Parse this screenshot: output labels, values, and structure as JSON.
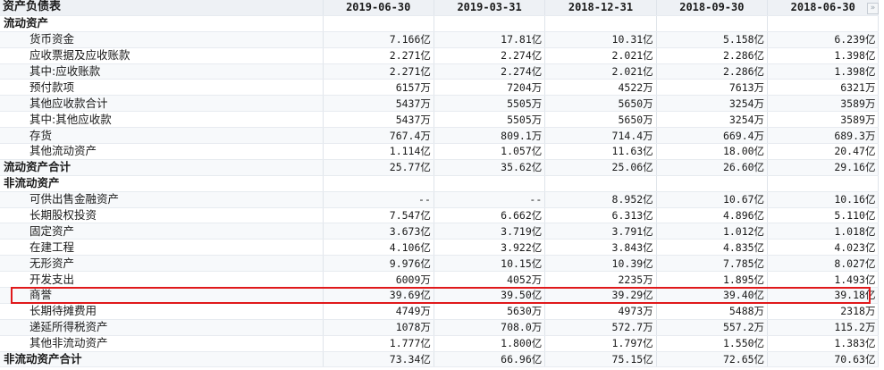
{
  "header": {
    "title": "资产负债表",
    "periods": [
      "2019-06-30",
      "2019-03-31",
      "2018-12-31",
      "2018-09-30",
      "2018-06-30"
    ],
    "scroll_glyph": "»"
  },
  "rows": [
    {
      "name": "流动资产",
      "type": "section",
      "values": [
        "",
        "",
        "",
        "",
        ""
      ]
    },
    {
      "name": "货币资金",
      "type": "sub",
      "values": [
        "7.166亿",
        "17.81亿",
        "10.31亿",
        "5.158亿",
        "6.239亿"
      ]
    },
    {
      "name": "应收票据及应收账款",
      "type": "sub",
      "values": [
        "2.271亿",
        "2.274亿",
        "2.021亿",
        "2.286亿",
        "1.398亿"
      ]
    },
    {
      "name": "其中:应收账款",
      "type": "sub",
      "values": [
        "2.271亿",
        "2.274亿",
        "2.021亿",
        "2.286亿",
        "1.398亿"
      ]
    },
    {
      "name": "预付款项",
      "type": "sub",
      "values": [
        "6157万",
        "7204万",
        "4522万",
        "7613万",
        "6321万"
      ]
    },
    {
      "name": "其他应收款合计",
      "type": "sub",
      "values": [
        "5437万",
        "5505万",
        "5650万",
        "3254万",
        "3589万"
      ]
    },
    {
      "name": "其中:其他应收款",
      "type": "sub",
      "values": [
        "5437万",
        "5505万",
        "5650万",
        "3254万",
        "3589万"
      ]
    },
    {
      "name": "存货",
      "type": "sub",
      "values": [
        "767.4万",
        "809.1万",
        "714.4万",
        "669.4万",
        "689.3万"
      ]
    },
    {
      "name": "其他流动资产",
      "type": "sub",
      "values": [
        "1.114亿",
        "1.057亿",
        "11.63亿",
        "18.00亿",
        "20.47亿"
      ]
    },
    {
      "name": "流动资产合计",
      "type": "section",
      "values": [
        "25.77亿",
        "35.62亿",
        "25.06亿",
        "26.60亿",
        "29.16亿"
      ]
    },
    {
      "name": "非流动资产",
      "type": "section",
      "values": [
        "",
        "",
        "",
        "",
        ""
      ]
    },
    {
      "name": "可供出售金融资产",
      "type": "sub",
      "values": [
        "--",
        "--",
        "8.952亿",
        "10.67亿",
        "10.16亿"
      ]
    },
    {
      "name": "长期股权投资",
      "type": "sub",
      "values": [
        "7.547亿",
        "6.662亿",
        "6.313亿",
        "4.896亿",
        "5.110亿"
      ]
    },
    {
      "name": "固定资产",
      "type": "sub",
      "values": [
        "3.673亿",
        "3.719亿",
        "3.791亿",
        "1.012亿",
        "1.018亿"
      ]
    },
    {
      "name": "在建工程",
      "type": "sub",
      "values": [
        "4.106亿",
        "3.922亿",
        "3.843亿",
        "4.835亿",
        "4.023亿"
      ]
    },
    {
      "name": "无形资产",
      "type": "sub",
      "values": [
        "9.976亿",
        "10.15亿",
        "10.39亿",
        "7.785亿",
        "8.027亿"
      ]
    },
    {
      "name": "开发支出",
      "type": "sub",
      "values": [
        "6009万",
        "4052万",
        "2235万",
        "1.895亿",
        "1.493亿"
      ]
    },
    {
      "name": "商誉",
      "type": "sub",
      "highlight": true,
      "values": [
        "39.69亿",
        "39.50亿",
        "39.29亿",
        "39.40亿",
        "39.18亿"
      ]
    },
    {
      "name": "长期待摊费用",
      "type": "sub",
      "values": [
        "4749万",
        "5630万",
        "4973万",
        "5488万",
        "2318万"
      ]
    },
    {
      "name": "递延所得税资产",
      "type": "sub",
      "values": [
        "1078万",
        "708.0万",
        "572.7万",
        "557.2万",
        "115.2万"
      ]
    },
    {
      "name": "其他非流动资产",
      "type": "sub",
      "values": [
        "1.777亿",
        "1.800亿",
        "1.797亿",
        "1.550亿",
        "1.383亿"
      ]
    },
    {
      "name": "非流动资产合计",
      "type": "section",
      "values": [
        "73.34亿",
        "66.96亿",
        "75.15亿",
        "72.65亿",
        "70.63亿"
      ]
    }
  ],
  "colors": {
    "highlight_border": "#e0191b",
    "header_bg": "#eef1f5"
  }
}
